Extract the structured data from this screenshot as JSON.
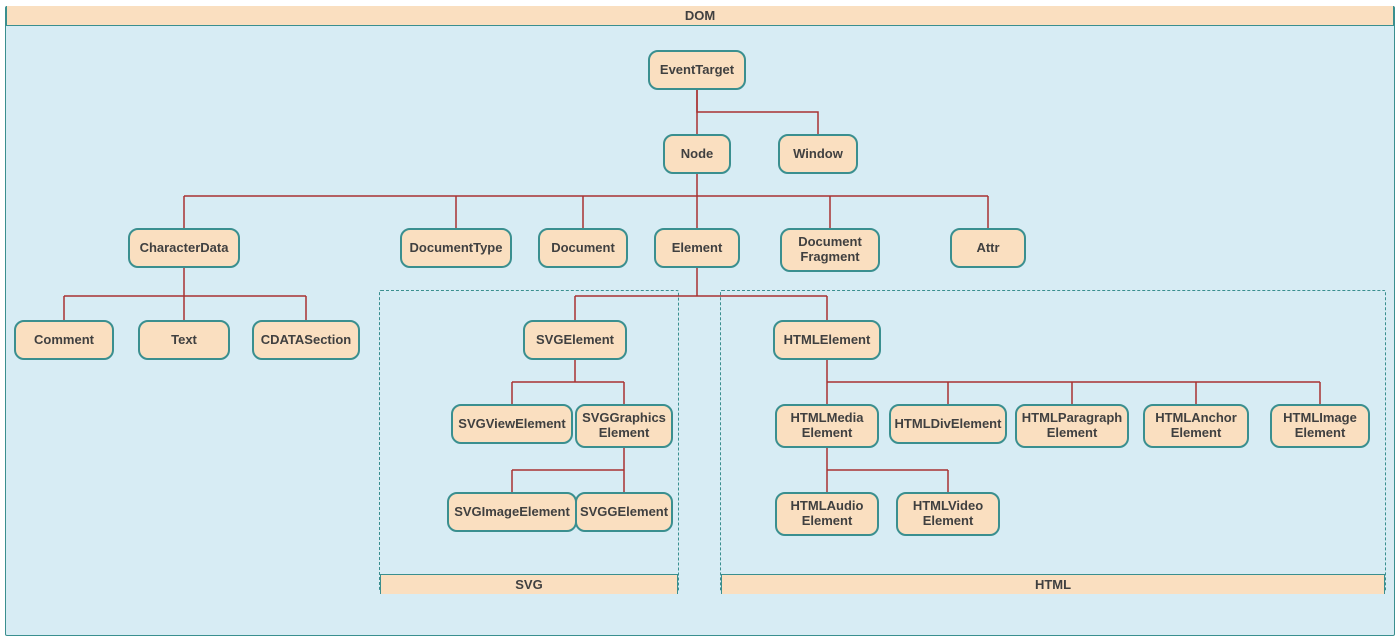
{
  "diagram": {
    "title": "DOM",
    "subframes": {
      "svg": "SVG",
      "html": "HTML"
    },
    "nodes": {
      "eventTarget": "EventTarget",
      "node": "Node",
      "window": "Window",
      "characterData": "CharacterData",
      "documentType": "DocumentType",
      "document": "Document",
      "element": "Element",
      "documentFragment": "Document Fragment",
      "attr": "Attr",
      "comment": "Comment",
      "text": "Text",
      "cdataSection": "CDATASection",
      "svgElement": "SVGElement",
      "svgViewElement": "SVGViewElement",
      "svgGraphicsElement": "SVGGraphics Element",
      "svgImageElement": "SVGImageElement",
      "svgGElement": "SVGGElement",
      "htmlElement": "HTMLElement",
      "htmlMediaElement": "HTMLMedia Element",
      "htmlDivElement": "HTMLDivElement",
      "htmlParagraphElement": "HTMLParagraph Element",
      "htmlAnchorElement": "HTMLAnchor Element",
      "htmlImageElement": "HTMLImage Element",
      "htmlAudioElement": "HTMLAudio Element",
      "htmlVideoElement": "HTMLVideo Element"
    },
    "hierarchy": {
      "EventTarget": [
        "Node",
        "Window"
      ],
      "Node": [
        "CharacterData",
        "DocumentType",
        "Document",
        "Element",
        "DocumentFragment",
        "Attr"
      ],
      "CharacterData": [
        "Comment",
        "Text",
        "CDATASection"
      ],
      "Element": [
        "SVGElement",
        "HTMLElement"
      ],
      "SVGElement": [
        "SVGViewElement",
        "SVGGraphicsElement"
      ],
      "SVGGraphicsElement": [
        "SVGImageElement",
        "SVGGElement"
      ],
      "HTMLElement": [
        "HTMLMediaElement",
        "HTMLDivElement",
        "HTMLParagraphElement",
        "HTMLAnchorElement",
        "HTMLImageElement"
      ],
      "HTMLMediaElement": [
        "HTMLAudioElement",
        "HTMLVideoElement"
      ]
    }
  }
}
